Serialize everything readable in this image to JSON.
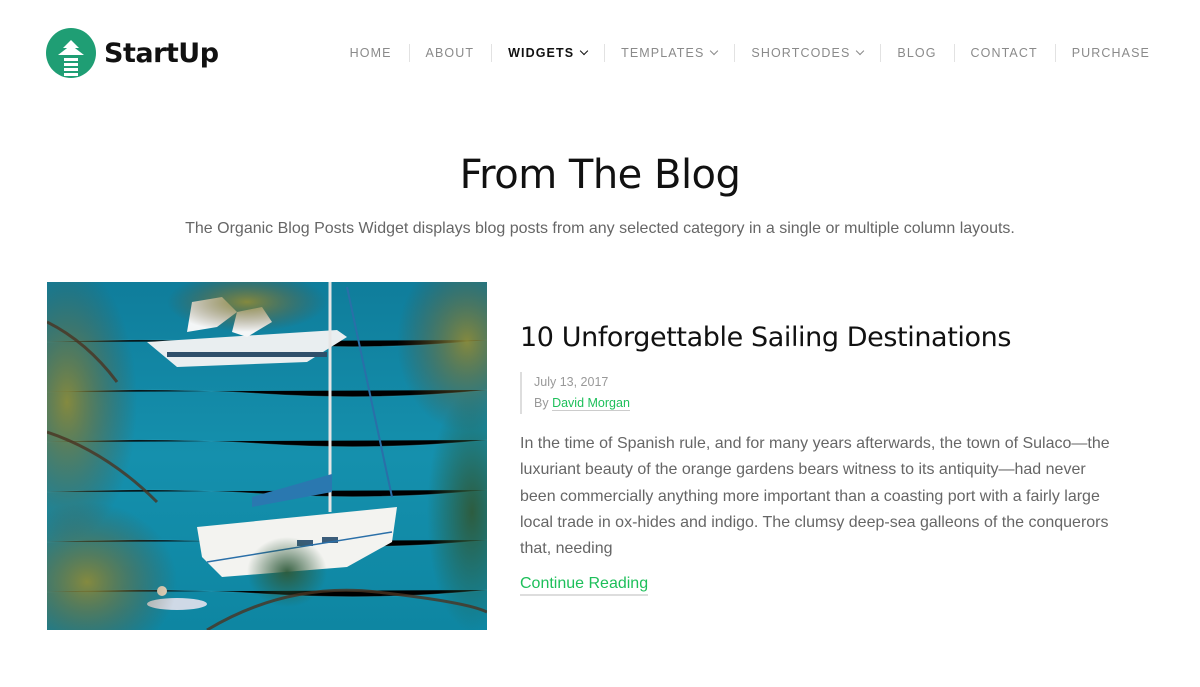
{
  "brand": {
    "name": "StartUp",
    "accent_color": "#1f9e74"
  },
  "nav": {
    "items": [
      {
        "label": "HOME",
        "dropdown": false,
        "active": false
      },
      {
        "label": "ABOUT",
        "dropdown": false,
        "active": false
      },
      {
        "label": "WIDGETS",
        "dropdown": true,
        "active": true
      },
      {
        "label": "TEMPLATES",
        "dropdown": true,
        "active": false
      },
      {
        "label": "SHORTCODES",
        "dropdown": true,
        "active": false
      },
      {
        "label": "BLOG",
        "dropdown": false,
        "active": false
      },
      {
        "label": "CONTACT",
        "dropdown": false,
        "active": false
      },
      {
        "label": "PURCHASE",
        "dropdown": false,
        "active": false
      }
    ]
  },
  "section": {
    "title": "From The Blog",
    "subtitle": "The Organic Blog Posts Widget displays blog posts from any selected category in a single or multiple column layouts."
  },
  "post": {
    "title": "10 Unforgettable Sailing Destinations",
    "date": "July 13, 2017",
    "by_label": "By",
    "author": "David Morgan",
    "excerpt": "In the time of Spanish rule, and for many years afterwards, the town of Sulaco—the luxuriant beauty of the orange gardens bears witness to its antiquity—had never been commercially anything more important than a coasting port with a fairly large local trade in ox-hides and indigo. The clumsy deep-sea galleons of the conquerors that, needing",
    "read_more": "Continue Reading",
    "image_alt": "Sailboat and motor yachts anchored in turquoise water seen through tree branches",
    "link_color": "#1dbf5a"
  }
}
